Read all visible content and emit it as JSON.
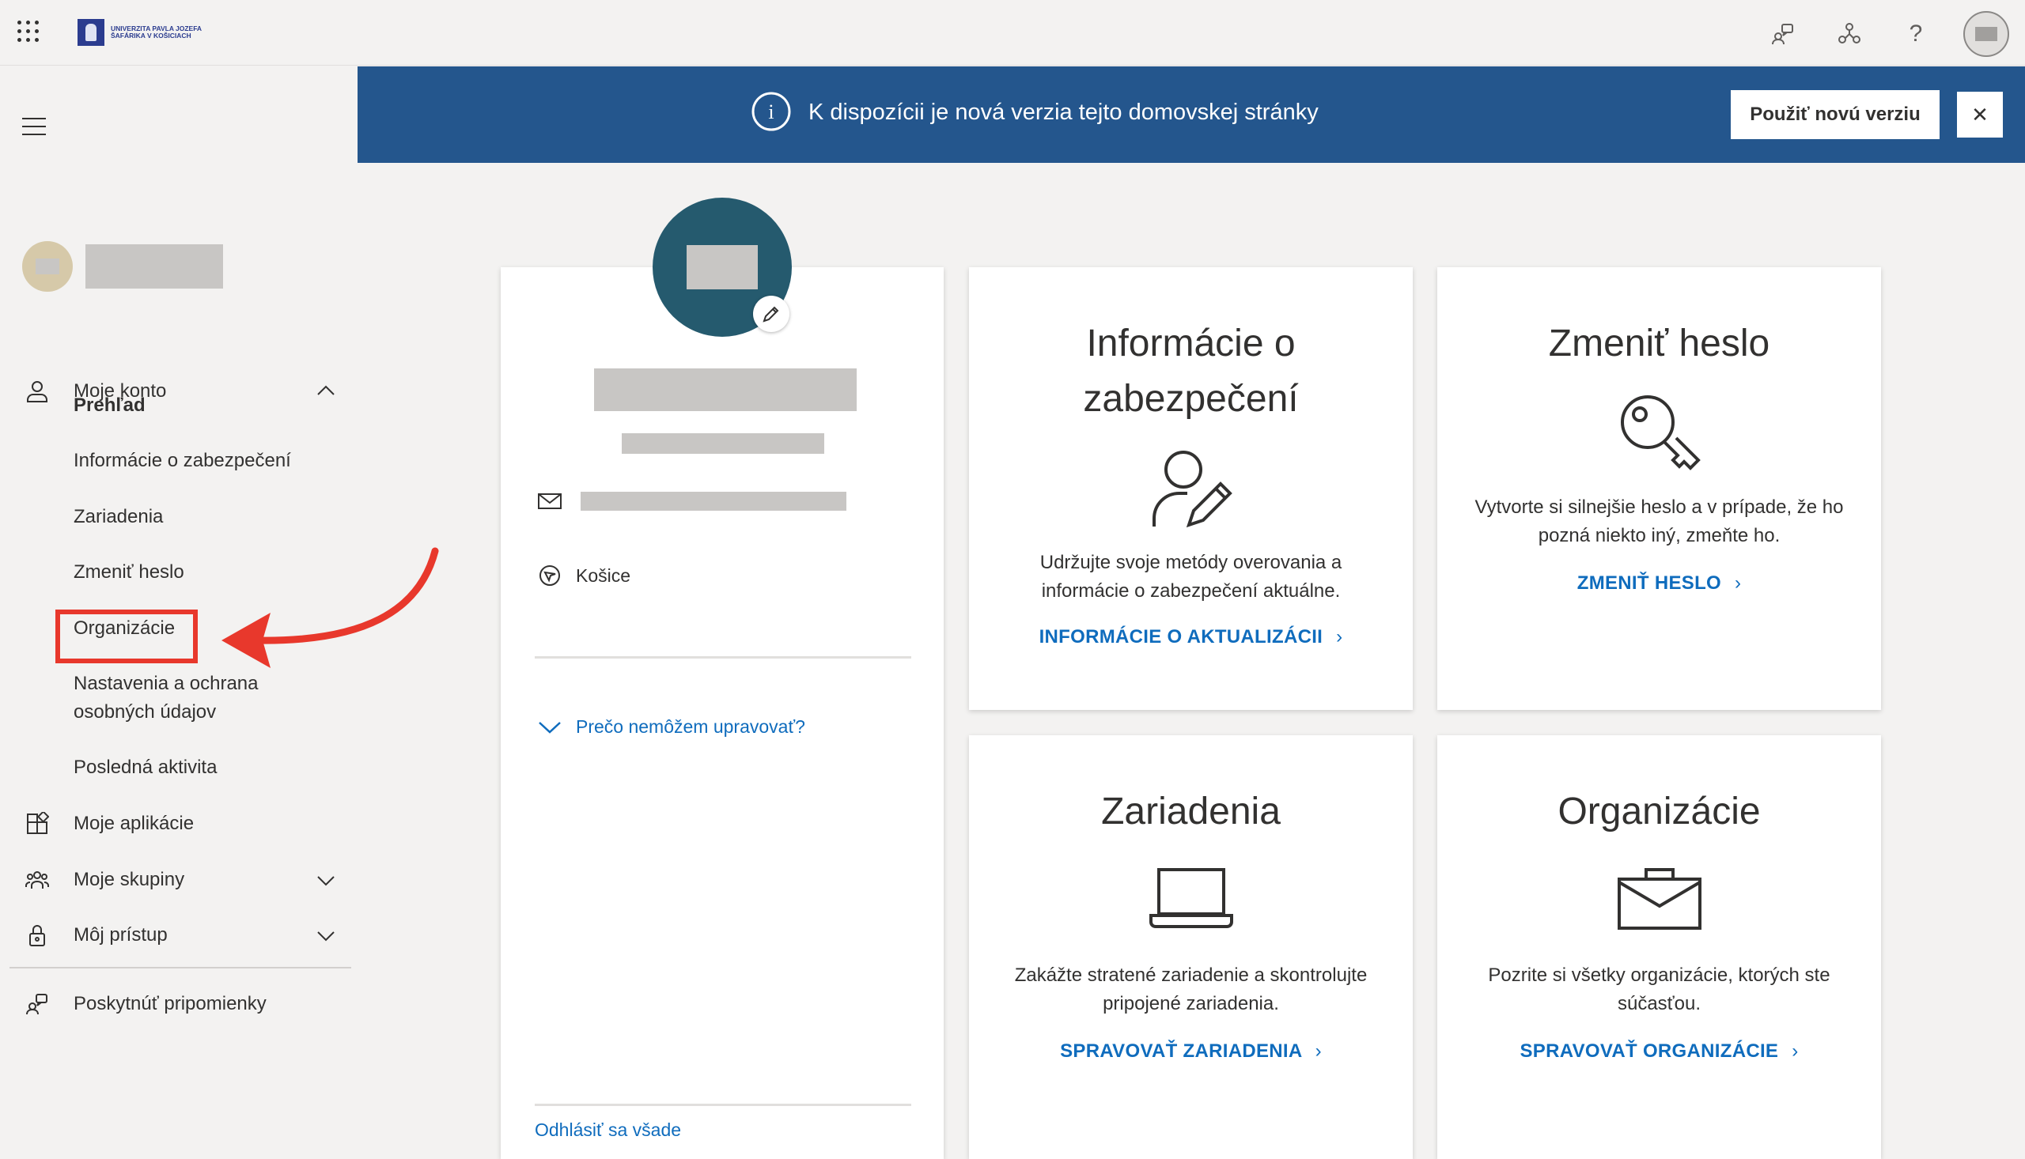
{
  "header": {
    "logo_text": "Univerzita Pavla Jozefa Šafárika v Košiciach",
    "icons": [
      "waffle-icon",
      "feedback-icon",
      "org-icon",
      "help-icon",
      "avatar"
    ],
    "help_glyph": "?"
  },
  "banner": {
    "text": "K dispozícii je nová verzia tejto domovskej stránky",
    "button_label": "Použiť novú verziu",
    "close_glyph": "✕",
    "info_glyph": "i",
    "background": "#24568d"
  },
  "sidebar": {
    "moje_konto": "Moje konto",
    "sub_items": [
      {
        "label": "Prehľad",
        "active": true
      },
      {
        "label": "Informácie o zabezpečení"
      },
      {
        "label": "Zariadenia"
      },
      {
        "label": "Zmeniť heslo",
        "highlighted": true
      },
      {
        "label": "Organizácie"
      },
      {
        "label": "Nastavenia a ochrana osobných údajov"
      },
      {
        "label": "Posledná aktivita"
      }
    ],
    "moje_aplikacie": "Moje aplikácie",
    "moje_skupiny": "Moje skupiny",
    "moj_pristup": "Môj prístup",
    "feedback": "Poskytnúť pripomienky"
  },
  "profile": {
    "location": "Košice",
    "why_cant_edit": "Prečo nemôžem upravovať?",
    "sign_out_all": "Odhlásiť sa všade"
  },
  "cards": {
    "security": {
      "title": "Informácie o zabezpečení",
      "description": "Udržujte svoje metódy overovania a informácie o zabezpečení aktuálne.",
      "link": "INFORMÁCIE O AKTUALIZÁCII",
      "icon": "person-edit-icon"
    },
    "password": {
      "title": "Zmeniť heslo",
      "description": "Vytvorte si silnejšie heslo a v prípade, že ho pozná niekto iný, zmeňte ho.",
      "link": "ZMENIŤ HESLO",
      "icon": "key-icon"
    },
    "devices": {
      "title": "Zariadenia",
      "description": "Zakážte stratené zariadenie a skontrolujte pripojené zariadenia.",
      "link": "SPRAVOVAŤ ZARIADENIA",
      "icon": "laptop-icon"
    },
    "organizations": {
      "title": "Organizácie",
      "description": "Pozrite si všetky organizácie, ktorých ste súčasťou.",
      "link": "SPRAVOVAŤ ORGANIZÁCIE",
      "icon": "briefcase-icon"
    }
  },
  "link_chevron": "›",
  "colors": {
    "accent_link": "#0f6cbd",
    "highlight_red": "#e8382c",
    "avatar_teal": "#255a6e"
  }
}
